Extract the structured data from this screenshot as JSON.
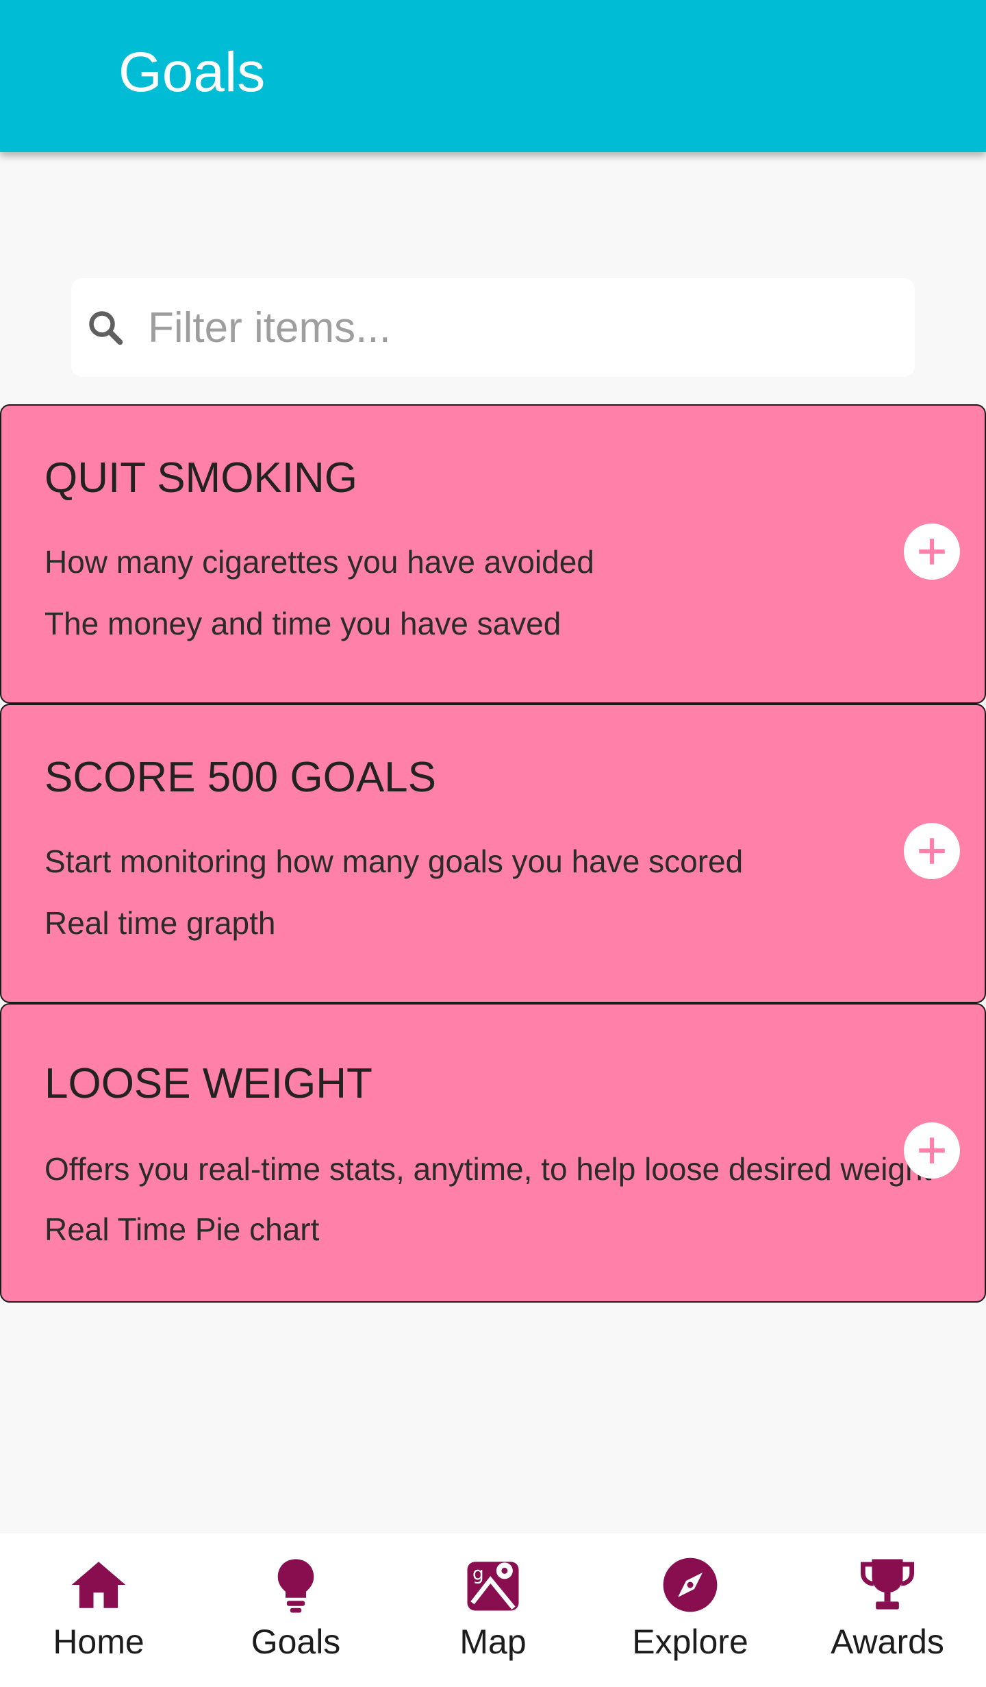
{
  "header": {
    "title": "Goals"
  },
  "search": {
    "placeholder": "Filter items...",
    "icon": "search-icon"
  },
  "goals": [
    {
      "title": "QUIT SMOKING",
      "line1": "How many cigarettes you have avoided",
      "line2": "The money and time you have saved"
    },
    {
      "title": "SCORE 500 GOALS",
      "line1": "Start monitoring how many goals you have scored",
      "line2": "Real time grapth"
    },
    {
      "title": "LOOSE WEIGHT",
      "line1": "Offers you real-time stats, anytime, to help loose desired weight",
      "line2": "Real Time Pie chart"
    }
  ],
  "bottom_nav": {
    "items": [
      {
        "label": "Home",
        "icon": "home-icon"
      },
      {
        "label": "Goals",
        "icon": "lightbulb-icon"
      },
      {
        "label": "Map",
        "icon": "map-icon"
      },
      {
        "label": "Explore",
        "icon": "compass-icon"
      },
      {
        "label": "Awards",
        "icon": "trophy-icon"
      }
    ]
  },
  "colors": {
    "header": "#00bcd4",
    "card": "#ff80a8",
    "nav_icon": "#880e4f",
    "background": "#f8f8f8"
  }
}
